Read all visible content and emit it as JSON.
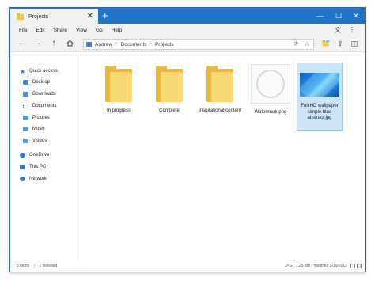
{
  "titlebar": {
    "tab_title": "Projects",
    "tab_close": "✕",
    "new_tab": "+",
    "minimize": "—",
    "maximize": "☐",
    "close": "✕"
  },
  "menu": {
    "items": [
      "File",
      "Edit",
      "Share",
      "View",
      "Go",
      "Help"
    ],
    "account_icon": "person-icon",
    "more_icon": "more-icon"
  },
  "address": {
    "back_icon": "arrow-left-icon",
    "forward_icon": "arrow-right-icon",
    "up_icon": "arrow-up-icon",
    "home_icon": "home-icon",
    "breadcrumb": [
      "Andrew",
      "Documents",
      "Projects"
    ],
    "separator": ">",
    "refresh_icon": "refresh-icon",
    "favorite_icon": "star-icon"
  },
  "sidebar": {
    "items": [
      {
        "label": "Quick access",
        "icon": "star-icon",
        "color": "#2b7bd6",
        "level": 0
      },
      {
        "label": "Desktop",
        "icon": "desktop-icon",
        "color": "#3a8ee6",
        "level": 1
      },
      {
        "label": "Downloads",
        "icon": "download-icon",
        "color": "#3a8ee6",
        "level": 1
      },
      {
        "label": "Documents",
        "icon": "documents-icon",
        "color": "#6a9ed8",
        "level": 1
      },
      {
        "label": "Pictures",
        "icon": "pictures-icon",
        "color": "#46a0e8",
        "level": 1
      },
      {
        "label": "Music",
        "icon": "music-icon",
        "color": "#46a0e8",
        "level": 1
      },
      {
        "label": "Videos",
        "icon": "videos-icon",
        "color": "#46a0e8",
        "level": 1
      },
      {
        "label": "OneDrive",
        "icon": "cloud-icon",
        "color": "#2b7bd6",
        "level": 0
      },
      {
        "label": "This PC",
        "icon": "computer-icon",
        "color": "#2b7bd6",
        "level": 0
      },
      {
        "label": "Network",
        "icon": "network-icon",
        "color": "#2b7bd6",
        "level": 0
      }
    ]
  },
  "files": [
    {
      "name": "In progress",
      "type": "folder",
      "selected": false
    },
    {
      "name": "Complete",
      "type": "folder",
      "selected": false
    },
    {
      "name": "Inspirational content",
      "type": "folder",
      "selected": false
    },
    {
      "name": "Watermark.png",
      "type": "image-watermark",
      "selected": false
    },
    {
      "name": "Full HD wallpaper simple blue abstract.jpg",
      "type": "image-wallpaper",
      "selected": true
    }
  ],
  "status": {
    "items": "5 items",
    "selected": "1 selected",
    "file_type": "JPG",
    "file_size": "1.25 MB",
    "modified": "modified 3/10/2019"
  },
  "colors": {
    "accent": "#1e74c9",
    "selection": "#cce4f7",
    "folder": "#f8d775"
  }
}
